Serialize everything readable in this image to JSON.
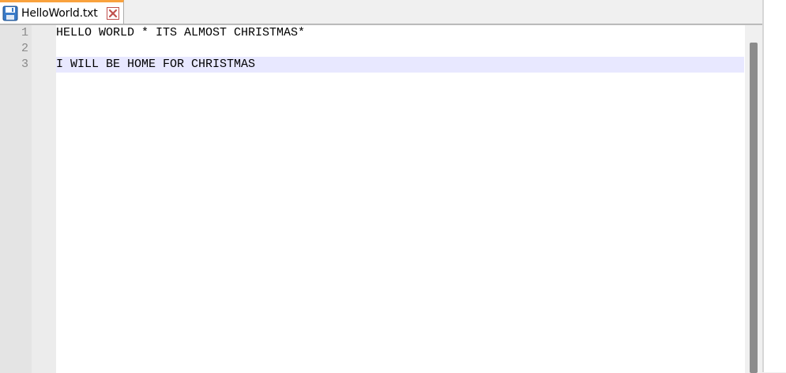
{
  "tab": {
    "filename": "HelloWorld.txt",
    "icon": "save-icon",
    "close_icon": "close-icon",
    "accent_color": "#f9a23e"
  },
  "editor": {
    "line_numbers": [
      "1",
      "2",
      "3"
    ],
    "lines": [
      "HELLO WORLD * ITS ALMOST CHRISTMAS*",
      "",
      "I WILL BE HOME FOR CHRISTMAS"
    ],
    "current_line": 3,
    "current_line_color": "#e8e8ff"
  }
}
